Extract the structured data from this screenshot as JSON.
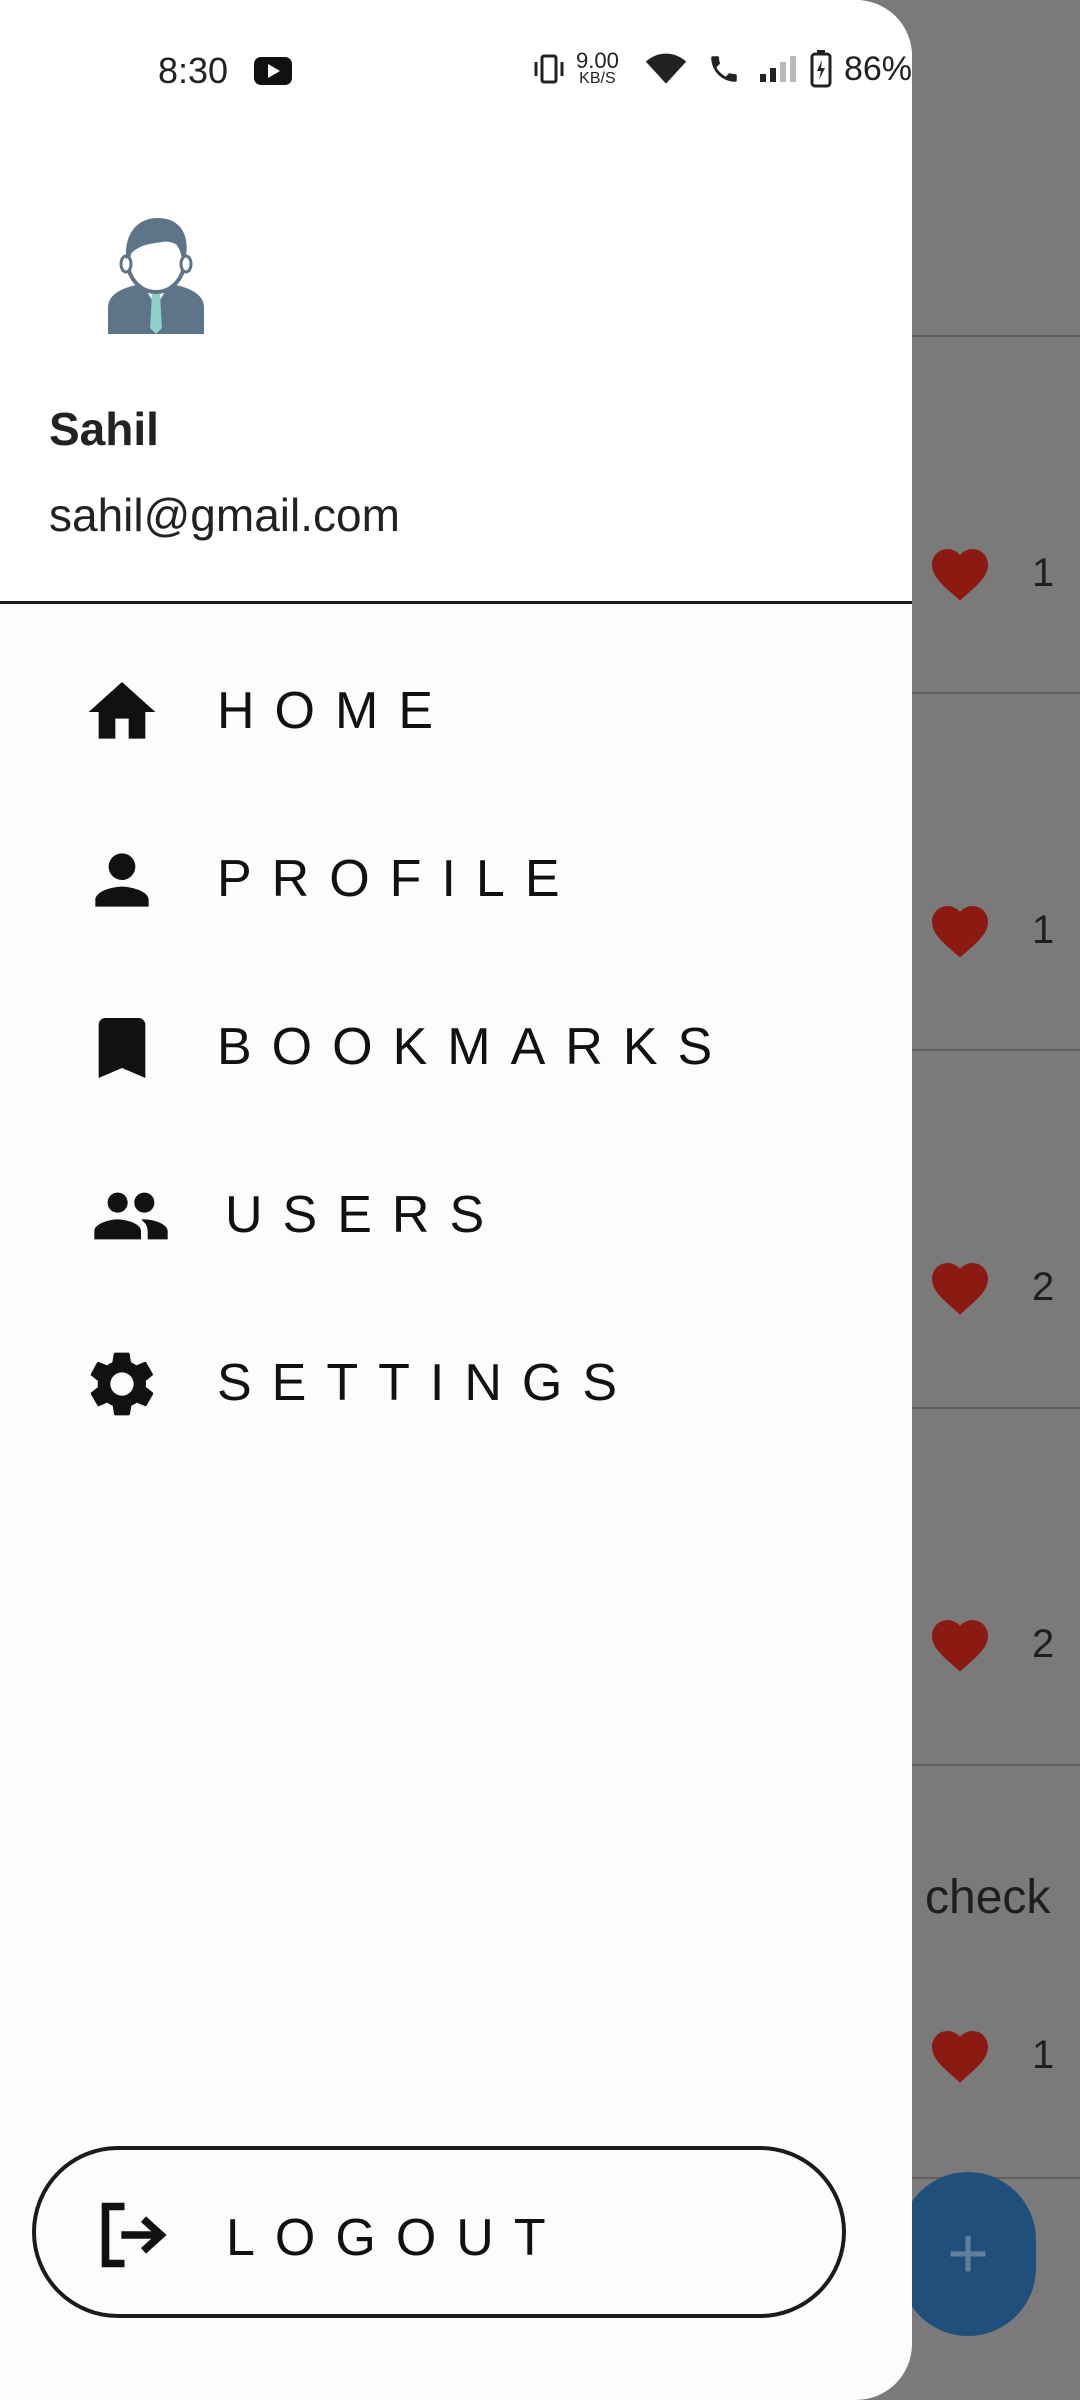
{
  "status_bar": {
    "time": "8:30",
    "net_speed_value": "9.00",
    "net_speed_unit": "KB/S",
    "battery": "86%"
  },
  "drawer": {
    "user": {
      "name": "Sahil",
      "email": "sahil@gmail.com"
    },
    "menu": [
      {
        "id": "home",
        "label": "HOME",
        "icon": "home-icon"
      },
      {
        "id": "profile",
        "label": "PROFILE",
        "icon": "person-icon"
      },
      {
        "id": "bookmarks",
        "label": "BOOKMARKS",
        "icon": "bookmark-icon"
      },
      {
        "id": "users",
        "label": "USERS",
        "icon": "group-icon"
      },
      {
        "id": "settings",
        "label": "SETTINGS",
        "icon": "gear-icon"
      }
    ],
    "logout_label": "LOGOUT"
  },
  "background_feed": {
    "like_counts": [
      "1",
      "1",
      "2",
      "2",
      "1"
    ],
    "post_text": "check",
    "fab_label": "+"
  },
  "colors": {
    "heart": "#8b1a12",
    "fab": "#1f4f7a",
    "avatar": "#5d7489"
  }
}
